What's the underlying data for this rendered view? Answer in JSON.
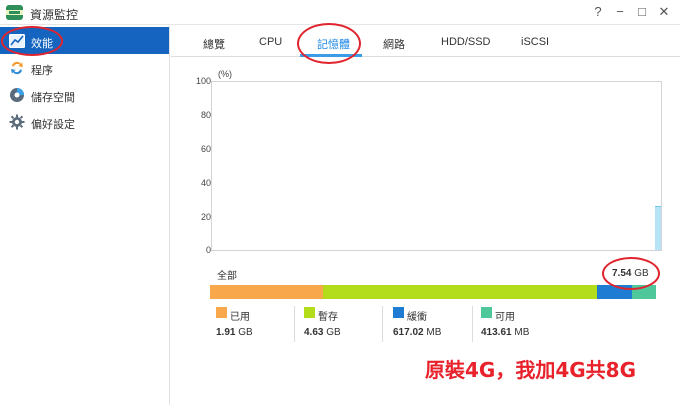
{
  "window": {
    "title": "資源監控",
    "controls": [
      "?",
      "−",
      "□",
      "✕"
    ]
  },
  "sidebar": {
    "items": [
      {
        "label": "效能",
        "icon": "chart-icon",
        "active": true
      },
      {
        "label": "程序",
        "icon": "process-icon",
        "active": false
      },
      {
        "label": "儲存空間",
        "icon": "storage-icon",
        "active": false
      },
      {
        "label": "偏好設定",
        "icon": "gear-icon",
        "active": false
      }
    ]
  },
  "tabs": [
    {
      "label": "總覽",
      "active": false
    },
    {
      "label": "CPU",
      "active": false
    },
    {
      "label": "記憶體",
      "active": true
    },
    {
      "label": "網路",
      "active": false
    },
    {
      "label": "HDD/SSD",
      "active": false
    },
    {
      "label": "iSCSI",
      "active": false
    }
  ],
  "chart_data": {
    "type": "area",
    "ylabel": "(%)",
    "yticks": [
      "100",
      "80",
      "60",
      "40",
      "20",
      "0"
    ],
    "ylim": [
      0,
      100
    ],
    "series": [
      {
        "values": [
          26
        ]
      }
    ],
    "grid": false
  },
  "memory": {
    "total_label": "全部",
    "total_value": "7.54",
    "total_unit": "GB",
    "segments": [
      {
        "name": "已用",
        "value": "1.91",
        "unit": "GB",
        "color": "#f8a84b",
        "fraction": 0.253
      },
      {
        "name": "暫存",
        "value": "4.63",
        "unit": "GB",
        "color": "#b3dc1b",
        "fraction": 0.614
      },
      {
        "name": "緩衝",
        "value": "617.02",
        "unit": "MB",
        "color": "#1e7cd2",
        "fraction": 0.08
      },
      {
        "name": "可用",
        "value": "413.61",
        "unit": "MB",
        "color": "#4ec79b",
        "fraction": 0.053
      }
    ]
  },
  "annotation": {
    "text": "原裝4G，我加4G共8G",
    "color": "#e8212b"
  }
}
